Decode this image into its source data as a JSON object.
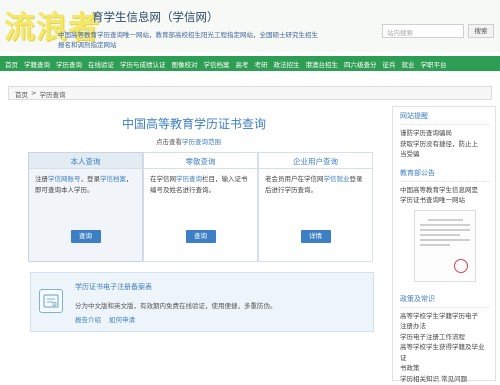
{
  "header": {
    "watermark": "流浪者",
    "site_title": "育学生信息网（学信网）",
    "notice_lines": [
      "中国高等教育学历查询唯一网站，教育部高校招生阳光工程指定网站，全国硕士研究生招生",
      "报名和调剂指定网站"
    ],
    "search_placeholder": "站内搜索",
    "search_button": "搜索"
  },
  "nav": [
    "首页",
    "学籍查询",
    "学历查询",
    "在线验证",
    "学历与成绩认证",
    "图像校对",
    "学信档案",
    "高考",
    "考研",
    "政法招生",
    "港澳台招生",
    "四六级查分",
    "征兵",
    "就业",
    "学职平台"
  ],
  "breadcrumb": {
    "home": "首页",
    "sep": ">",
    "current": "学历查询"
  },
  "main": {
    "title": "中国高等教育学历证书查询",
    "subtitle_prefix": "点击查看",
    "subtitle_link": "学历查询范围",
    "cards": [
      {
        "head": "本人查询",
        "body": [
          "注册",
          "学信网账号",
          "，登录",
          "学信档",
          "案",
          "，即可查询本人学历。"
        ],
        "button": "查询"
      },
      {
        "head": "零散查询",
        "body": [
          "在学信网",
          "学历查询",
          "栏目，输入",
          "证书编号及姓名进行查询。"
        ],
        "button": "查询"
      },
      {
        "head": "企业用户查询",
        "body": [
          "老会员用户在学信网",
          "学信就业",
          "登录后进行学历查询。"
        ],
        "button": "详情"
      }
    ],
    "cert": {
      "title": "学历证书电子注册备案表",
      "desc": "分为中文版和英文版，有效期内免费在线验证，使用便捷，多重防伪。",
      "links": [
        "报告介绍",
        "如何申请"
      ]
    }
  },
  "sidebar": {
    "sections": [
      {
        "head": "网站提醒",
        "lines": [
          "谨防学历查询骗局",
          "获取学历没有捷径，防止上",
          "当受骗"
        ]
      },
      {
        "head": "教育部公告",
        "lines": [
          "中国高等教育学生信息网是",
          "学历证书查询唯一网站"
        ]
      },
      {
        "head": "政策及常识",
        "lines": [
          "高等学校学生学籍学历电子",
          "注册办法",
          "学历电子注册工作流程",
          "高等学校学生获得学籍及毕业证",
          "书政策",
          "学历相关知识   常见问题"
        ]
      }
    ]
  },
  "colors": {
    "nav_green": "#2f9e55",
    "link_blue": "#3c7fc4",
    "watermark_yellow": "#f5e76a"
  }
}
